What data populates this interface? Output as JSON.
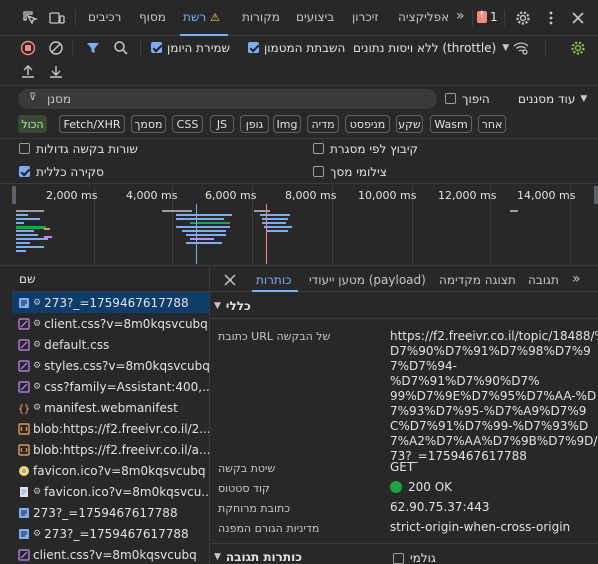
{
  "toolbar": {
    "tabs": [
      {
        "label": "רכיבים"
      },
      {
        "label": "מסוף"
      },
      {
        "label": "רשת"
      },
      {
        "label": "מקורות"
      },
      {
        "label": "ביצועים"
      },
      {
        "label": "זיכרון"
      },
      {
        "label": "אפליקציה"
      }
    ],
    "more_tabs": "»",
    "issue_count": "1"
  },
  "network_bar": {
    "preserve_log": "שמירת היומן",
    "disable_cache": "השבתת המטמון",
    "throttle": "ללא ויסות נתונים (throttle)"
  },
  "filter": {
    "placeholder": "מסנן",
    "invert": "היפוך",
    "more_filters": "עוד מסננים"
  },
  "type_filters": [
    "הכול",
    "Fetch/XHR",
    "מסמך",
    "CSS",
    "JS",
    "גופן",
    "Img",
    "מדיה",
    "מניפסט",
    "שקע",
    "Wasm",
    "אחר"
  ],
  "options": {
    "big_rows": "שורות בקשה גדולות",
    "group_by_frame": "קיבוץ לפי מסגרת",
    "overview": "סקירה כללית",
    "screenshots": "צילומי מסך"
  },
  "overview_ticks": [
    "2,000 ms",
    "4,000 ms",
    "6,000 ms",
    "8,000 ms",
    "10,000 ms",
    "12,000 ms",
    "14,000 ms"
  ],
  "requests": {
    "header": "שם",
    "items": [
      {
        "name": "273?_=1759467617788",
        "gear": true,
        "icon": "doc"
      },
      {
        "name": "client.css?v=8m0kqsvcubq",
        "gear": true,
        "icon": "css"
      },
      {
        "name": "default.css",
        "gear": true,
        "icon": "css"
      },
      {
        "name": "styles.css?v=8m0kqsvcubq",
        "gear": true,
        "icon": "css"
      },
      {
        "name": "css?family=Assistant:400,...",
        "gear": true,
        "icon": "css"
      },
      {
        "name": "manifest.webmanifest",
        "gear": true,
        "icon": "manifest"
      },
      {
        "name": "blob:https://f2.freeivr.co.il/2...",
        "gear": false,
        "icon": "blob"
      },
      {
        "name": "blob:https://f2.freeivr.co.il/a...",
        "gear": false,
        "icon": "blob"
      },
      {
        "name": "favicon.ico?v=8m0kqsvcubq",
        "gear": false,
        "icon": "img"
      },
      {
        "name": "favicon.ico?v=8m0kqsvcu...",
        "gear": true,
        "icon": "page"
      },
      {
        "name": "273?_=1759467617788",
        "gear": false,
        "icon": "doc"
      },
      {
        "name": "273?_=1759467617788",
        "gear": true,
        "icon": "doc"
      },
      {
        "name": "client.css?v=8m0kqsvcubq",
        "gear": false,
        "icon": "css"
      }
    ]
  },
  "details": {
    "tabs": [
      "כותרות",
      "מטען ייעודי (payload)",
      "תצוגה מקדימה",
      "תגובה"
    ],
    "more": "»",
    "general_section": "כללי",
    "url_key": "כתובת URL של הבקשה",
    "url_lines": [
      "https://f2.freeivr.co.il/topic/18488/%",
      "D7%90%D7%91%D7%98%D7%9",
      "7%D7%94-%D7%91%D7%90%D7%",
      "99%D7%9E%D7%95%D7%AA-%D",
      "7%93%D7%95-%D7%A9%D7%9",
      "C%D7%91%D7%99-%D7%93%D",
      "7%A2%D7%AA%D7%9B%D7%9D/2",
      "73?_=1759467617788"
    ],
    "method_key": "שיטת בקשה",
    "method_val": "GET",
    "status_key": "קוד סטטוס",
    "status_val": "200 OK",
    "remote_key": "כתובת מרוחקת",
    "remote_val": "62.90.75.37:443",
    "referrer_key": "מדיניות הגורם המפנה",
    "referrer_val": "strict-origin-when-cross-origin",
    "response_headers": "כותרות תגובה",
    "raw": "גולמי"
  },
  "colors": {
    "accent": "#7cacf8",
    "status_ok": "#1ea446",
    "record_red": "#f28b82",
    "warning": "#fdd663"
  }
}
